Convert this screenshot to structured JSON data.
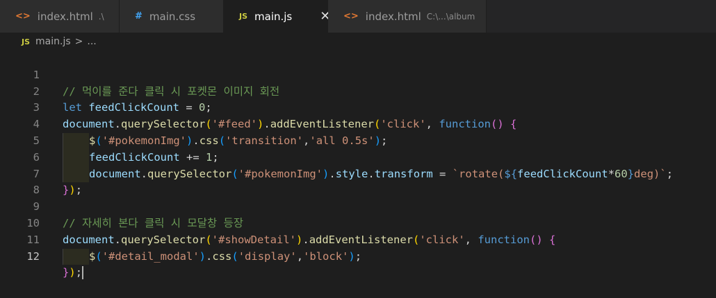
{
  "tabs": [
    {
      "icon": "html-file-icon",
      "label": "index.html",
      "hint": ".\\",
      "active": false
    },
    {
      "icon": "css-file-icon",
      "label": "main.css",
      "hint": "",
      "active": false
    },
    {
      "icon": "js-file-icon",
      "label": "main.js",
      "hint": "",
      "active": true
    },
    {
      "icon": "html-file-icon",
      "label": "index.html",
      "hint": "C:\\...\\album",
      "active": false
    }
  ],
  "tab_icons": {
    "html": "<>",
    "css": "#",
    "js": "JS",
    "close": "✕"
  },
  "breadcrumb": {
    "file": "main.js",
    "separator": ">",
    "symbol": "..."
  },
  "editor": {
    "current_line": 12,
    "line_numbers": [
      "1",
      "2",
      "3",
      "4",
      "5",
      "6",
      "7",
      "8",
      "9",
      "10",
      "11",
      "12"
    ],
    "lines": {
      "l1_comment": "// 먹이를 준다 클릭 시 포켓몬 이미지 회전",
      "l2": {
        "kw": "let",
        "var": "feedClickCount",
        "op": " = ",
        "num": "0",
        "end": ";"
      },
      "l3": {
        "obj": "document",
        "dot": ".",
        "fn": "querySelector",
        "p1": "(",
        "str": "'#feed'",
        "p1c": ")",
        "dot2": ".",
        "fn2": "addEventListener",
        "p2": "(",
        "str2": "'click'",
        "comma": ", ",
        "kw": "function",
        "p3": "()",
        "sp": " ",
        "brace": "{"
      },
      "l4": {
        "fn": "$",
        "p1": "(",
        "str": "'#pokemonImg'",
        "p1c": ")",
        "dot": ".",
        "fn2": "css",
        "p2": "(",
        "str2": "'transition'",
        "comma": ",",
        "str3": "'all 0.5s'",
        "p2c": ")",
        "end": ";"
      },
      "l5": {
        "var": "feedClickCount",
        "op": " += ",
        "num": "1",
        "end": ";"
      },
      "l6": {
        "obj": "document",
        "dot": ".",
        "fn": "querySelector",
        "p1": "(",
        "str": "'#pokemonImg'",
        "p1c": ")",
        "dot2": ".",
        "prop": "style",
        "dot3": ".",
        "prop2": "transform",
        "op": " = ",
        "tpl1": "`rotate(",
        "ds": "${",
        "var": "feedClickCount",
        "op2": "*",
        "num": "60",
        "de": "}",
        "tpl2": "deg)`",
        "end": ";"
      },
      "l7": {
        "brace": "}",
        "paren": ")",
        "end": ";"
      },
      "l9_comment": "// 자세히 본다 클릭 시 모달창 등장",
      "l10": {
        "obj": "document",
        "dot": ".",
        "fn": "querySelector",
        "p1": "(",
        "str": "'#showDetail'",
        "p1c": ")",
        "dot2": ".",
        "fn2": "addEventListener",
        "p2": "(",
        "str2": "'click'",
        "comma": ", ",
        "kw": "function",
        "p3": "()",
        "sp": " ",
        "brace": "{"
      },
      "l11": {
        "fn": "$",
        "p1": "(",
        "str": "'#detail_modal'",
        "p1c": ")",
        "dot": ".",
        "fn2": "css",
        "p2": "(",
        "str2": "'display'",
        "comma": ",",
        "str3": "'block'",
        "p2c": ")",
        "end": ";"
      },
      "l12": {
        "brace": "}",
        "paren": ")",
        "end": ";"
      }
    }
  }
}
